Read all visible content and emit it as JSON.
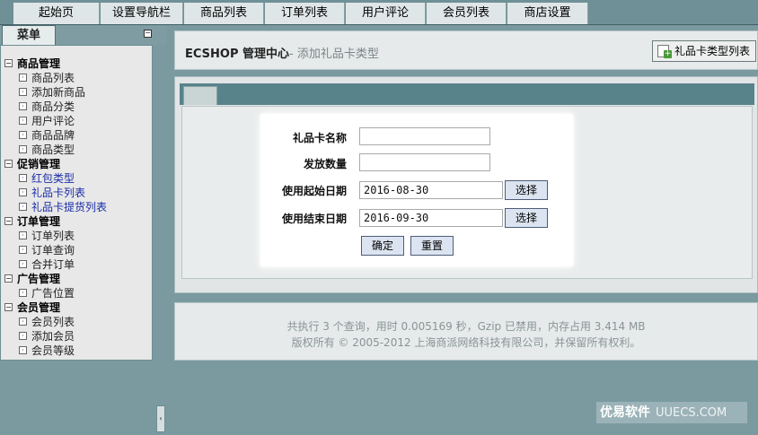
{
  "top_nav": [
    "起始页",
    "设置导航栏",
    "商品列表",
    "订单列表",
    "用户评论",
    "会员列表",
    "商店设置"
  ],
  "sidebar": {
    "tab_label": "菜单",
    "toggle_glyph": "−",
    "groups": [
      {
        "label": "商品管理",
        "items": [
          "商品列表",
          "添加新商品",
          "商品分类",
          "用户评论",
          "商品品牌",
          "商品类型"
        ]
      },
      {
        "label": "促销管理",
        "items": [
          "红包类型",
          "礼品卡列表",
          "礼品卡提货列表"
        ]
      },
      {
        "label": "订单管理",
        "items": [
          "订单列表",
          "订单查询",
          "合并订单"
        ]
      },
      {
        "label": "广告管理",
        "items": [
          "广告位置"
        ]
      },
      {
        "label": "会员管理",
        "items": [
          "会员列表",
          "添加会员",
          "会员等级"
        ]
      }
    ],
    "collapse_glyph": "‹"
  },
  "header": {
    "title": "ECSHOP 管理中心",
    "subtitle": "- 添加礼品卡类型",
    "list_button": "礼品卡类型列表"
  },
  "form": {
    "name_label": "礼品卡名称",
    "name_value": "",
    "count_label": "发放数量",
    "count_value": "",
    "start_label": "使用起始日期",
    "start_value": "2016-08-30",
    "end_label": "使用结束日期",
    "end_value": "2016-09-30",
    "choose_label": "选择",
    "submit_label": "确定",
    "reset_label": "重置"
  },
  "footer": {
    "line1": "共执行 3 个查询，用时 0.005169 秒，Gzip 已禁用，内存占用 3.414 MB",
    "line2": "版权所有 © 2005-2012 上海商派网络科技有限公司，并保留所有权利。"
  },
  "watermark": {
    "brand": "优易软件",
    "site": "UUECS.COM"
  }
}
